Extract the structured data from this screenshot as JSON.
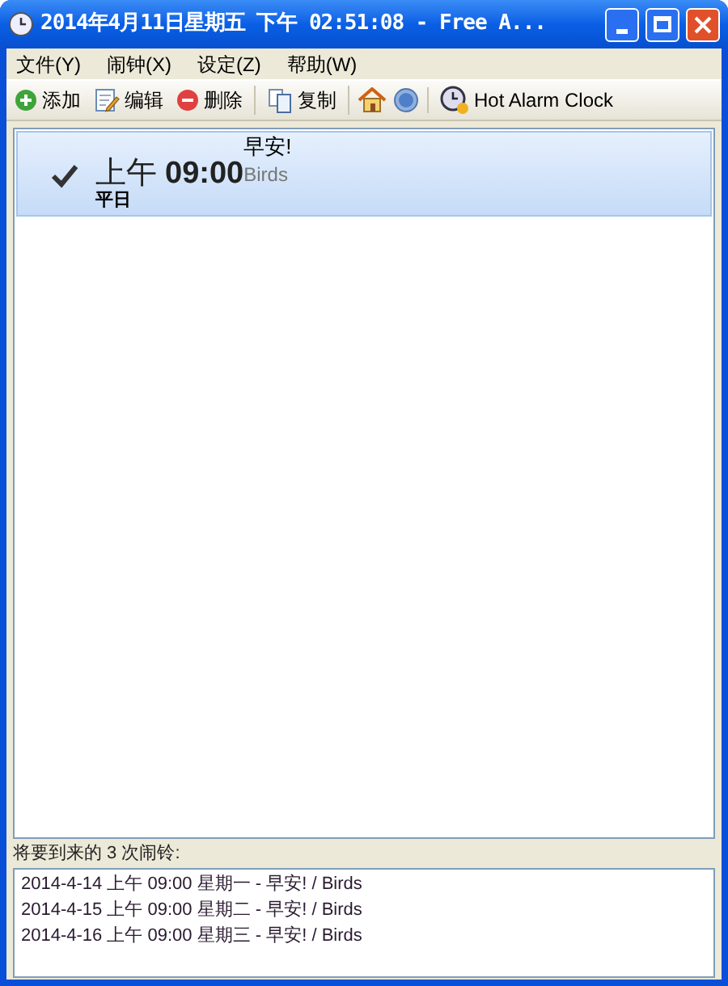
{
  "window": {
    "title": "2014年4月11日星期五  下午  02:51:08 - Free A..."
  },
  "menu": [
    "文件(Y)",
    "闹钟(X)",
    "设定(Z)",
    "帮助(W)"
  ],
  "toolbar": {
    "groups": [
      [
        {
          "kind": "add",
          "label": "添加"
        },
        {
          "kind": "edit",
          "label": "编辑"
        },
        {
          "kind": "delete",
          "label": "删除"
        }
      ],
      [
        {
          "kind": "copy",
          "label": "复制"
        }
      ],
      [
        {
          "kind": "home"
        },
        {
          "kind": "help"
        }
      ],
      [
        {
          "kind": "clock",
          "label": "Hot Alarm Clock"
        }
      ]
    ]
  },
  "alarms": [
    {
      "checked": true,
      "selected": true,
      "period": "上午",
      "time": "09:00",
      "repeat": "平日",
      "message": "早安!",
      "sound": "Birds"
    }
  ],
  "upcoming": {
    "heading": "将要到来的 3 次闹铃:",
    "items": [
      "2014-4-14 上午 09:00 星期一 - 早安! / Birds",
      "2014-4-15 上午 09:00 星期二 - 早安! / Birds",
      "2014-4-16 上午 09:00 星期三 - 早安! / Birds"
    ]
  }
}
